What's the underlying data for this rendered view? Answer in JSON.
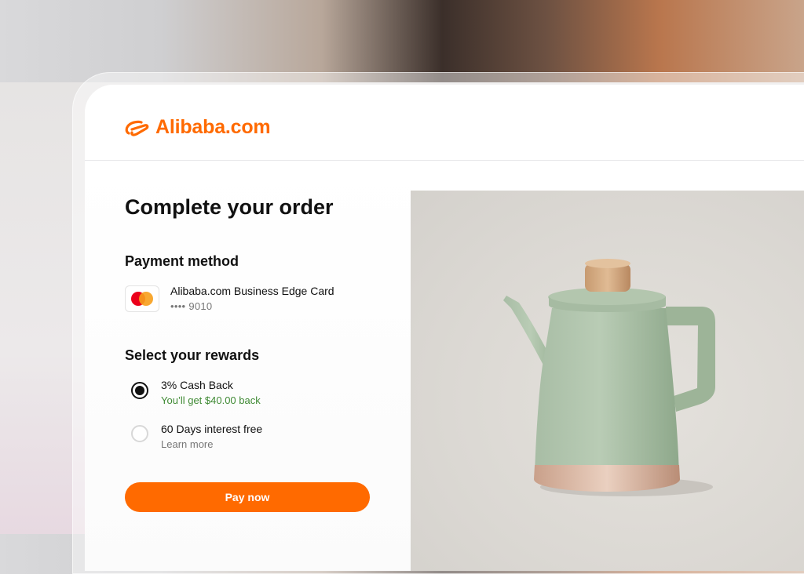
{
  "brand": {
    "name": "Alibaba.com",
    "color": "#ff6a00"
  },
  "checkout": {
    "title": "Complete your order",
    "payment_method": {
      "label": "Payment method",
      "card_name": "Alibaba.com Business Edge Card",
      "card_number": "•••• 9010",
      "card_icon": "mastercard-icon"
    },
    "rewards": {
      "label": "Select your rewards",
      "options": [
        {
          "title": "3% Cash Back",
          "subtitle": "You’ll get $40.00 back",
          "selected": true
        },
        {
          "title": "60 Days interest free",
          "subtitle": "Learn more",
          "selected": false
        }
      ]
    },
    "pay_button": "Pay now"
  },
  "product": {
    "image": "green-teapot"
  }
}
